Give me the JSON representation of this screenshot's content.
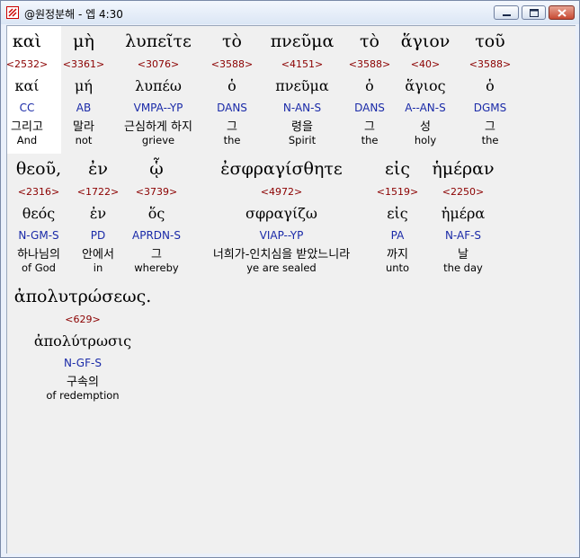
{
  "window": {
    "title": "@원정분해 - 엡 4:30"
  },
  "rows": [
    [
      {
        "greek": "καὶ",
        "strong": "<2532>",
        "lemma": "καί",
        "parse": "CC",
        "korean": "그리고",
        "english": "And"
      },
      {
        "greek": "μὴ",
        "strong": "<3361>",
        "lemma": "μή",
        "parse": "AB",
        "korean": "말라",
        "english": "not"
      },
      {
        "greek": "λυπεῖτε",
        "strong": "<3076>",
        "lemma": "λυπέω",
        "parse": "VMPA--YP",
        "korean": "근심하게 하지",
        "english": "grieve"
      },
      {
        "greek": "τὸ",
        "strong": "<3588>",
        "lemma": "ὁ",
        "parse": "DANS",
        "korean": "그",
        "english": "the"
      },
      {
        "greek": "πνεῦμα",
        "strong": "<4151>",
        "lemma": "πνεῦμα",
        "parse": "N-AN-S",
        "korean": "령을",
        "english": "Spirit"
      },
      {
        "greek": "τὸ",
        "strong": "<3588>",
        "lemma": "ὁ",
        "parse": "DANS",
        "korean": "그",
        "english": "the"
      },
      {
        "greek": "ἅγιον",
        "strong": "<40>",
        "lemma": "ἅγιος",
        "parse": "A--AN-S",
        "korean": "성",
        "english": "holy"
      },
      {
        "greek": "τοῦ",
        "strong": "<3588>",
        "lemma": "ὁ",
        "parse": "DGMS",
        "korean": "그",
        "english": "the"
      }
    ],
    [
      {
        "greek": "θεοῦ,",
        "strong": "<2316>",
        "lemma": "θεός",
        "parse": "N-GM-S",
        "korean": "하나님의",
        "english": "of God"
      },
      {
        "greek": "ἐν",
        "strong": "<1722>",
        "lemma": "ἐν",
        "parse": "PD",
        "korean": "안에서",
        "english": "in"
      },
      {
        "greek": "ᾧ",
        "strong": "<3739>",
        "lemma": "ὅς",
        "parse": "APRDN-S",
        "korean": "그",
        "english": "whereby"
      },
      {
        "greek": "ἐσφραγίσθητε",
        "strong": "<4972>",
        "lemma": "σφραγίζω",
        "parse": "VIAP--YP",
        "korean": "너희가-인치심을 받았느니라",
        "english": "ye are sealed"
      },
      {
        "greek": "εἰς",
        "strong": "<1519>",
        "lemma": "εἰς",
        "parse": "PA",
        "korean": "까지",
        "english": "unto"
      },
      {
        "greek": "ἡμέραν",
        "strong": "<2250>",
        "lemma": "ἡμέρα",
        "parse": "N-AF-S",
        "korean": "날",
        "english": "the day"
      }
    ],
    [
      {
        "greek": "ἀπολυτρώσεως.",
        "strong": "<629>",
        "lemma": "ἀπολύτρωσις",
        "parse": "N-GF-S",
        "korean": "구속의",
        "english": "of redemption"
      }
    ]
  ]
}
